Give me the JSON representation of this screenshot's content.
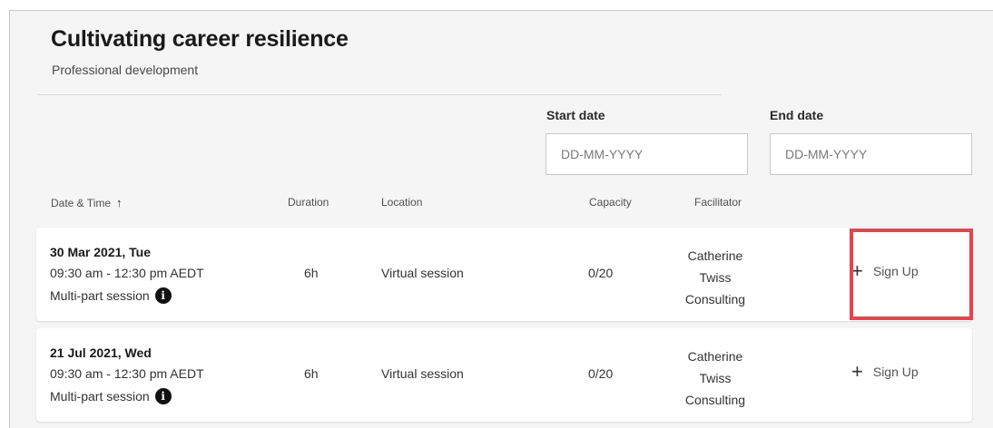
{
  "header": {
    "title": "Cultivating career resilience",
    "subtitle": "Professional development"
  },
  "filters": {
    "start_label": "Start date",
    "start_placeholder": "DD-MM-YYYY",
    "end_label": "End date",
    "end_placeholder": "DD-MM-YYYY"
  },
  "columns": {
    "date_time": "Date & Time",
    "duration": "Duration",
    "location": "Location",
    "capacity": "Capacity",
    "facilitator": "Facilitator"
  },
  "sessions": [
    {
      "date": "30 Mar 2021, Tue",
      "time": "09:30 am - 12:30 pm AEDT",
      "multipart": "Multi-part session",
      "duration": "6h",
      "location": "Virtual session",
      "capacity": "0/20",
      "facilitator_lines": [
        "Catherine",
        "Twiss",
        "Consulting"
      ],
      "action": "Sign Up"
    },
    {
      "date": "21 Jul 2021, Wed",
      "time": "09:30 am - 12:30 pm AEDT",
      "multipart": "Multi-part session",
      "duration": "6h",
      "location": "Virtual session",
      "capacity": "0/20",
      "facilitator_lines": [
        "Catherine",
        "Twiss",
        "Consulting"
      ],
      "action": "Sign Up"
    }
  ],
  "icons": {
    "sort": "arrow-up-icon",
    "info": "info-icon",
    "plus": "plus-icon"
  },
  "colors": {
    "highlight": "#e8434d",
    "panel_bg": "#f5f5f5"
  }
}
